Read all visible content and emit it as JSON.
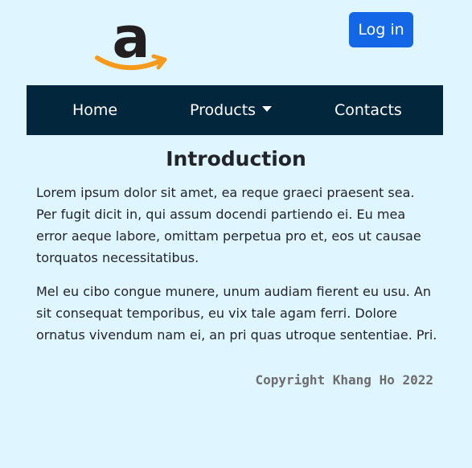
{
  "header": {
    "logo_icon": "amazon-logo",
    "login_label": "Log in",
    "login_color": "#1367e6"
  },
  "navbar": {
    "background": "#02263c",
    "items": [
      {
        "label": "Home"
      },
      {
        "label": "Products",
        "icon": "caret-down-icon"
      },
      {
        "label": "Contacts"
      }
    ]
  },
  "main": {
    "title": "Introduction",
    "paragraphs": [
      "Lorem ipsum dolor sit amet, ea reque graeci praesent sea. Per fugit dicit in, qui assum docendi partiendo ei. Eu mea error aeque labore, omittam perpetua pro et, eos ut causae torquatos necessitatibus.",
      "Mel eu cibo congue munere, unum audiam fierent eu usu. An sit consequat temporibus, eu vix tale agam ferri. Dolore ornatus vivendum nam ei, an pri quas utroque sententiae. Pri."
    ]
  },
  "footer": {
    "copyright": "Copyright Khang Ho 2022"
  },
  "colors": {
    "page_background": "#dff5ff",
    "logo_orange": "#f79a1b",
    "logo_black": "#231f20"
  }
}
